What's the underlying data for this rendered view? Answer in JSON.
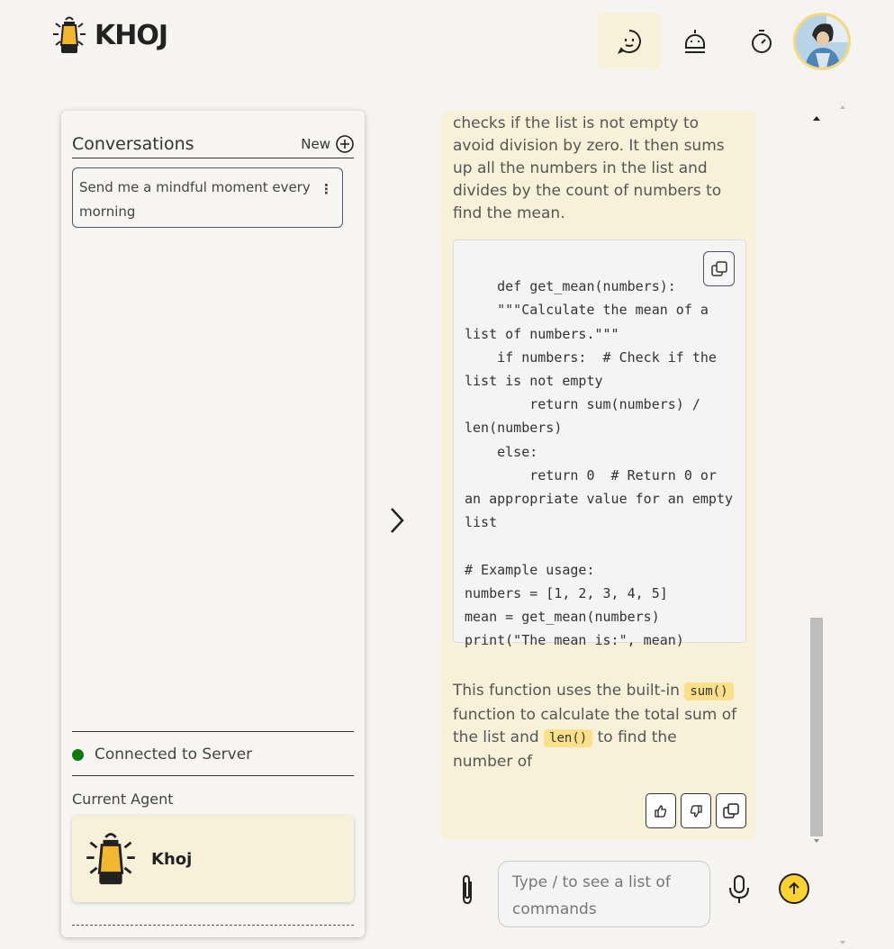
{
  "app": {
    "logo_text": "KHOJ"
  },
  "nav": {
    "items": [
      "chat-icon",
      "agent-icon",
      "automation-icon"
    ]
  },
  "sidebar": {
    "title": "Conversations",
    "new_label": "New",
    "conversations": [
      {
        "title": "Send me a mindful moment every morning"
      }
    ],
    "status": "Connected to Server",
    "current_agent_label": "Current Agent",
    "agent_name": "Khoj"
  },
  "chat": {
    "intro_text": "checks if the list is not empty to avoid division by zero. It then sums up all the numbers in the list and divides by the count of numbers to find the mean.",
    "code": "def get_mean(numbers):\n    \"\"\"Calculate the mean of a list of numbers.\"\"\"\n    if numbers:  # Check if the list is not empty\n        return sum(numbers) / len(numbers)\n    else:\n        return 0  # Return 0 or an appropriate value for an empty list\n\n# Example usage:\nnumbers = [1, 2, 3, 4, 5]\nmean = get_mean(numbers)\nprint(\"The mean is:\", mean)",
    "outro_part1": "This function uses the built-in ",
    "outro_code1": "sum()",
    "outro_part2": " function to calculate the total sum of the list and ",
    "outro_code2": "len()",
    "outro_part3": " to find the number of"
  },
  "input": {
    "placeholder": "Type / to see a list of commands"
  },
  "colors": {
    "accent": "#fbd22e",
    "message_bg": "#f8f1d9",
    "status_green": "#0b7a0b"
  }
}
